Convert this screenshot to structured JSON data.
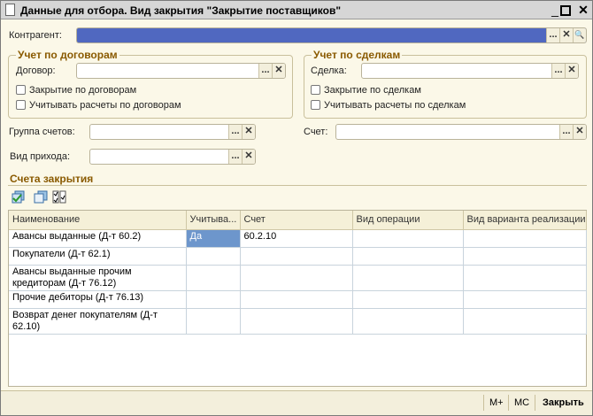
{
  "window": {
    "title": "Данные для отбора. Вид закрытия \"Закрытие поставщиков\""
  },
  "kontragent": {
    "label": "Контрагент:",
    "value": ""
  },
  "group_contracts": {
    "title": "Учет по договорам",
    "field_label": "Договор:",
    "value": "",
    "check1": "Закрытие по договорам",
    "check2": "Учитывать расчеты по договорам"
  },
  "group_deals": {
    "title": "Учет по сделкам",
    "field_label": "Сделка:",
    "value": "",
    "check1": "Закрытие по сделкам",
    "check2": "Учитывать расчеты по сделкам"
  },
  "account_group": {
    "label": "Группа счетов:",
    "value": ""
  },
  "account": {
    "label": "Счет:",
    "value": ""
  },
  "income_type": {
    "label": "Вид прихода:",
    "value": ""
  },
  "section": {
    "title": "Счета закрытия"
  },
  "buttons": {
    "ellipsis": "...",
    "clear": "✕",
    "search": "🔍"
  },
  "table": {
    "columns": [
      "Наименование",
      "Учитыва...",
      "Счет",
      "Вид операции",
      "Вид варианта реализации"
    ],
    "rows": [
      [
        "Авансы выданные (Д-т 60.2)",
        "Да",
        "60.2.10",
        "",
        ""
      ],
      [
        "Покупатели (Д-т 62.1)",
        "",
        "",
        "",
        ""
      ],
      [
        "Авансы выданные прочим кредиторам (Д-т 76.12)",
        "",
        "",
        "",
        ""
      ],
      [
        "Прочие дебиторы (Д-т 76.13)",
        "",
        "",
        "",
        ""
      ],
      [
        "Возврат денег покупателям (Д-т 62.10)",
        "",
        "",
        "",
        ""
      ]
    ]
  },
  "footer": {
    "mplus": "M+",
    "mc": "MC",
    "close": "Закрыть"
  }
}
